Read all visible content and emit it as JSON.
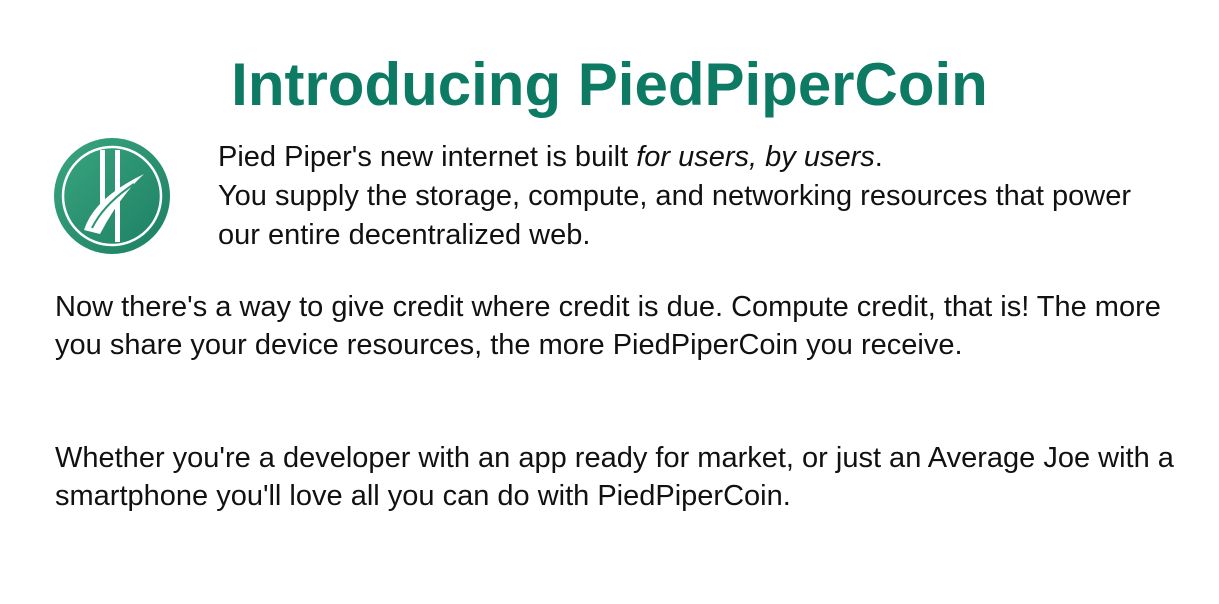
{
  "title": "Introducing PiedPiperCoin",
  "intro": {
    "line1_prefix": "Pied Piper's new internet is built ",
    "line1_emphasis": "for users, by users",
    "line1_suffix": ".",
    "line2": "You supply the storage, compute, and networking resources that power our entire decentralized web."
  },
  "paragraphs": [
    "Now there's a way to give credit where credit is due. Compute credit, that is! The more you share your device resources, the more PiedPiperCoin you receive.",
    "Whether you're a developer with an app ready for market, or just an Average Joe with a smartphone you'll love all you can do with PiedPiperCoin."
  ],
  "logo": {
    "icon": "piedpipercoin-logo",
    "colors": {
      "outer": "#1f8a67",
      "inner": "#2e9a74",
      "mark": "#ffffff"
    }
  },
  "colors": {
    "title": "#0d7a63",
    "text": "#111111",
    "background": "#ffffff"
  }
}
